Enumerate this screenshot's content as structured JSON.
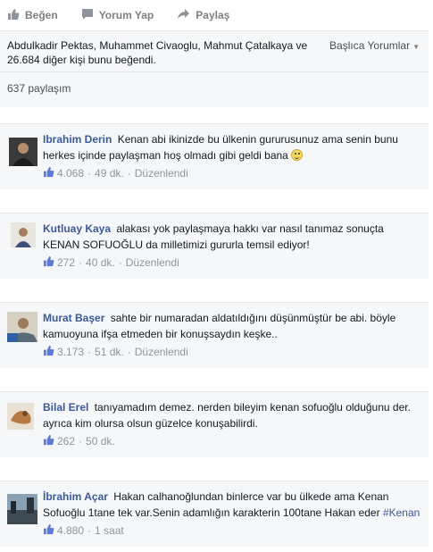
{
  "actions": {
    "like_label": "Beğen",
    "comment_label": "Yorum Yap",
    "share_label": "Paylaş"
  },
  "likes": {
    "text": "Abdulkadir Pektas, Muhammet Civaoglu, Mahmut Çatalkaya ve 26.684 diğer kişi bunu beğendi.",
    "sort_label": "Başlıca Yorumlar"
  },
  "shares": {
    "text": "637 paylaşım"
  },
  "comments": [
    {
      "name": "Ibrahim Derin",
      "text": "Kenan abi ikinizde bu ülkenin gururusunuz ama senin bunu herkes içinde paylaşman hoş olmadı gibi geldi bana",
      "likes": "4.068",
      "time": "49 dk.",
      "edited": "Düzenlendi"
    },
    {
      "name": "Kutluay Kaya",
      "text": "alakası yok paylaşmaya hakkı var nasıl tanımaz sonuçta KENAN SOFUOĞLU da milletimizi gururla temsil ediyor!",
      "likes": "272",
      "time": "40 dk.",
      "edited": "Düzenlendi"
    },
    {
      "name": "Murat Başer",
      "text": "sahte bir numaradan aldatıldığını düşünmüştür be abi. böyle kamuoyuna ifşa etmeden bir konuşsaydın keşke..",
      "likes": "3.173",
      "time": "51 dk.",
      "edited": "Düzenlendi"
    },
    {
      "name": "Bilal Erel",
      "text": "tanıyamadım demez. nerden bileyim kenan sofuoğlu olduğunu der. ayrıca kim olursa olsun güzelce konuşabilirdi.",
      "likes": "262",
      "time": "50 dk."
    },
    {
      "name": "İbrahim Açar",
      "text": "Hakan calhanoğlundan binlerce var bu ülkede ama Kenan Sofuoğlu 1tane tek var.Senin adamlığın karakterin 100tane Hakan eder",
      "hashtag": "#Kenan",
      "likes": "4.880",
      "time": "1 saat"
    }
  ],
  "colors": {
    "link_blue": "#3b5998",
    "meta_gray": "#90949c",
    "panel_bg": "#f6f7f8"
  }
}
